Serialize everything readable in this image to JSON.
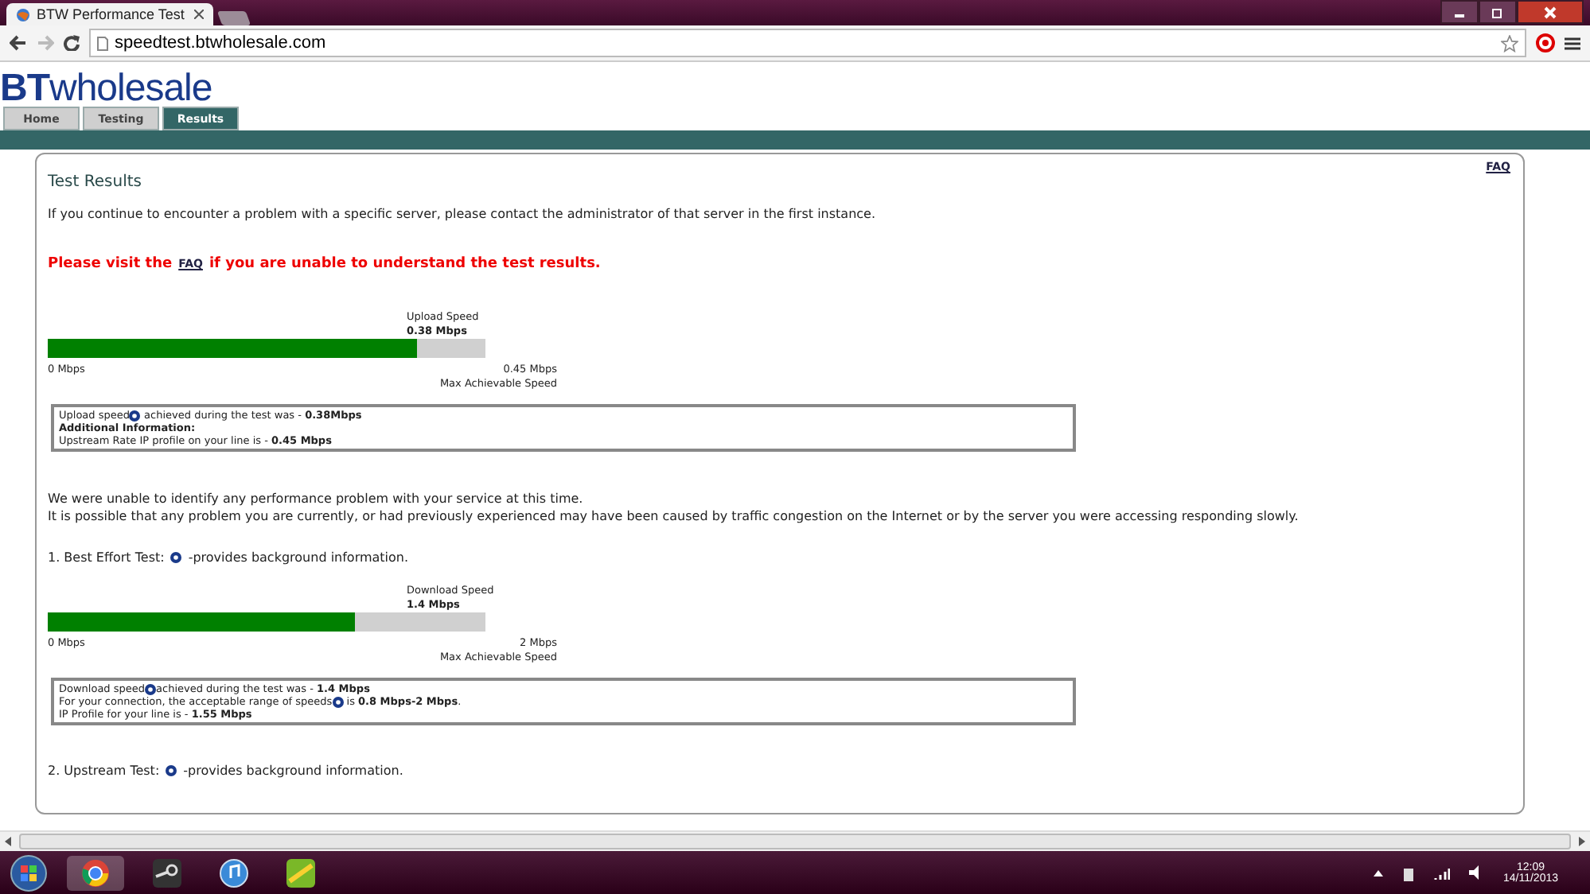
{
  "browser": {
    "tab_title": "BTW Performance Test",
    "url": "speedtest.btwholesale.com"
  },
  "site": {
    "logo_bold": "BT",
    "logo_text": "wholesale",
    "nav": [
      {
        "label": "Home",
        "selected": false
      },
      {
        "label": "Testing",
        "selected": false
      },
      {
        "label": "Results",
        "selected": true
      }
    ]
  },
  "panel": {
    "faq_link": "FAQ",
    "title": "Test Results",
    "intro": "If you continue to encounter a problem with a specific server, please contact the administrator of that server in the first instance.",
    "notice": {
      "before": "Please visit the",
      "link": "FAQ",
      "after": "if you are unable to understand the test results."
    },
    "sections": [
      {
        "kind": "meter",
        "meter": {
          "caption": "Upload Speed",
          "value": "0.38 Mbps",
          "level": 0.844,
          "min": "0 Mbps",
          "max": "0.45 Mbps",
          "max_caption": "Max Achievable Speed"
        },
        "info": [
          [
            {
              "kind": "text",
              "text": "Upload speed"
            },
            {
              "kind": "help"
            },
            {
              "kind": "text",
              "text": " achieved during the test was - **0.38Mbps**"
            }
          ],
          [
            {
              "kind": "text",
              "text": "**Additional Information:**"
            }
          ],
          [
            {
              "kind": "text",
              "text": "Upstream Rate IP profile on your line is - **0.45 Mbps**"
            }
          ]
        ]
      },
      {
        "kind": "text",
        "lines": [
          "We were unable to identify any performance problem with your service at this time.",
          "It is possible that any problem you are currently, or had previously experienced may have been caused by traffic congestion on the Internet or by the server you were accessing responding slowly."
        ]
      },
      {
        "kind": "heading",
        "before": "1. Best Effort Test:",
        "after": "-provides background information."
      },
      {
        "kind": "meter",
        "meter": {
          "caption": "Download  Speed",
          "value": "1.4 Mbps",
          "level": 0.7,
          "min": "0 Mbps",
          "max": "2 Mbps",
          "max_caption": "Max Achievable Speed"
        },
        "info": [
          [
            {
              "kind": "text",
              "text": "Download speed"
            },
            {
              "kind": "help"
            },
            {
              "kind": "text",
              "text": "achieved during the test was - **1.4 Mbps**"
            }
          ],
          [
            {
              "kind": "text",
              "text": "For your connection, the acceptable range of speeds"
            },
            {
              "kind": "help"
            },
            {
              "kind": "text",
              "text": " is **0.8 Mbps-2 Mbps**."
            }
          ],
          [
            {
              "kind": "text",
              "text": "IP Profile for your line is - **1.55 Mbps**"
            }
          ]
        ]
      },
      {
        "kind": "heading",
        "before": "2. Upstream Test:",
        "after": "-provides background information."
      }
    ]
  },
  "taskbar": {
    "time": "12:09",
    "date": "14/11/2013"
  }
}
